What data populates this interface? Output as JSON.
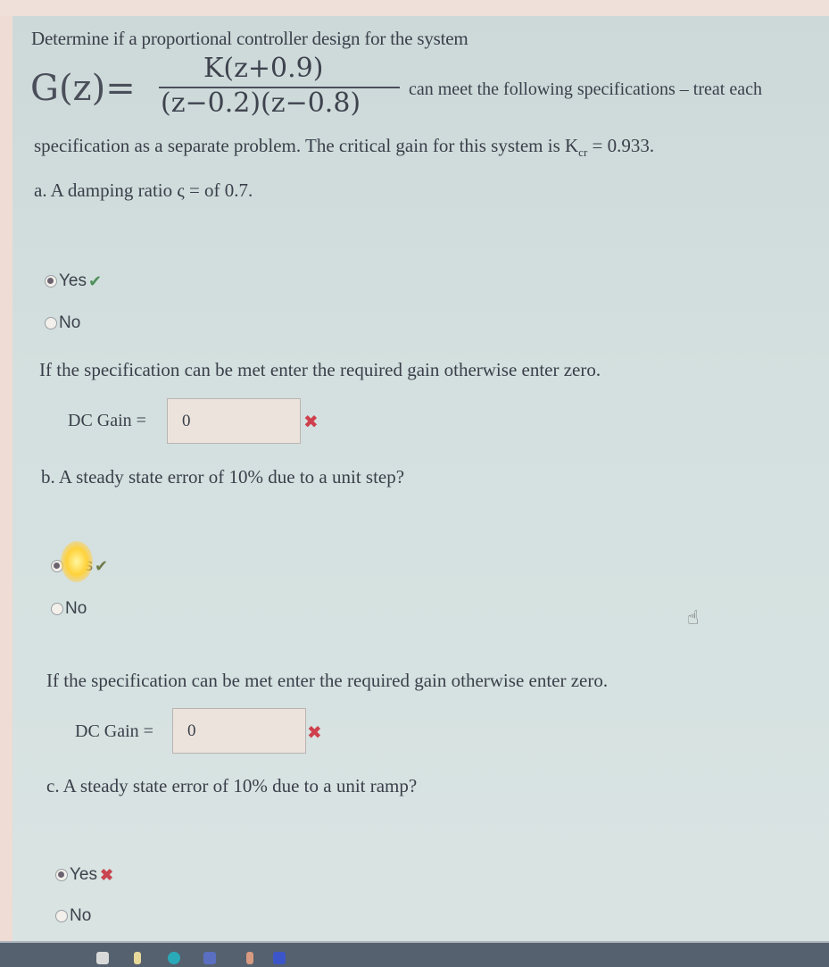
{
  "question": {
    "intro": "Determine if a proportional controller design for the system",
    "equation": {
      "lhs": "G(z)=",
      "numerator": "K(z+0.9)",
      "denominator": "(z−0.2)(z−0.8)"
    },
    "after_equation": "can meet the following specifications – treat each",
    "line2_prefix": "specification as a separate problem. The critical gain for this system is K",
    "line2_sub": "cr",
    "line2_suffix": " = 0.933."
  },
  "parts": [
    {
      "label": "a. A damping ratio ς = of 0.7.",
      "options": [
        {
          "label": "Yes",
          "checked": true,
          "feedback": "correct"
        },
        {
          "label": "No",
          "checked": false,
          "feedback": ""
        }
      ],
      "gain_prompt": "If the specification can be met enter the required gain otherwise enter zero.",
      "gain_label": "DC Gain =",
      "gain_value": "0",
      "gain_feedback": "incorrect"
    },
    {
      "label": "b. A steady state error  of 10% due to a unit step?",
      "options": [
        {
          "label": "Yes",
          "checked": true,
          "feedback": "correct"
        },
        {
          "label": "No",
          "checked": false,
          "feedback": ""
        }
      ],
      "gain_prompt": "If the specification can be met enter the required gain otherwise enter zero.",
      "gain_label": "DC Gain =",
      "gain_value": "0",
      "gain_feedback": "incorrect"
    },
    {
      "label": "c. A steady state error of 10% due to a unit ramp?",
      "options": [
        {
          "label": "Yes",
          "checked": true,
          "feedback": "incorrect"
        },
        {
          "label": "No",
          "checked": false,
          "feedback": ""
        }
      ]
    }
  ],
  "icons": {
    "correct": "✔",
    "incorrect": "✖",
    "cursor": "hand-pointer"
  },
  "colors": {
    "correct": "#4f8f5a",
    "incorrect": "#cf3f4c",
    "panel": "#d4e0df",
    "taskbar": "#55616e"
  }
}
